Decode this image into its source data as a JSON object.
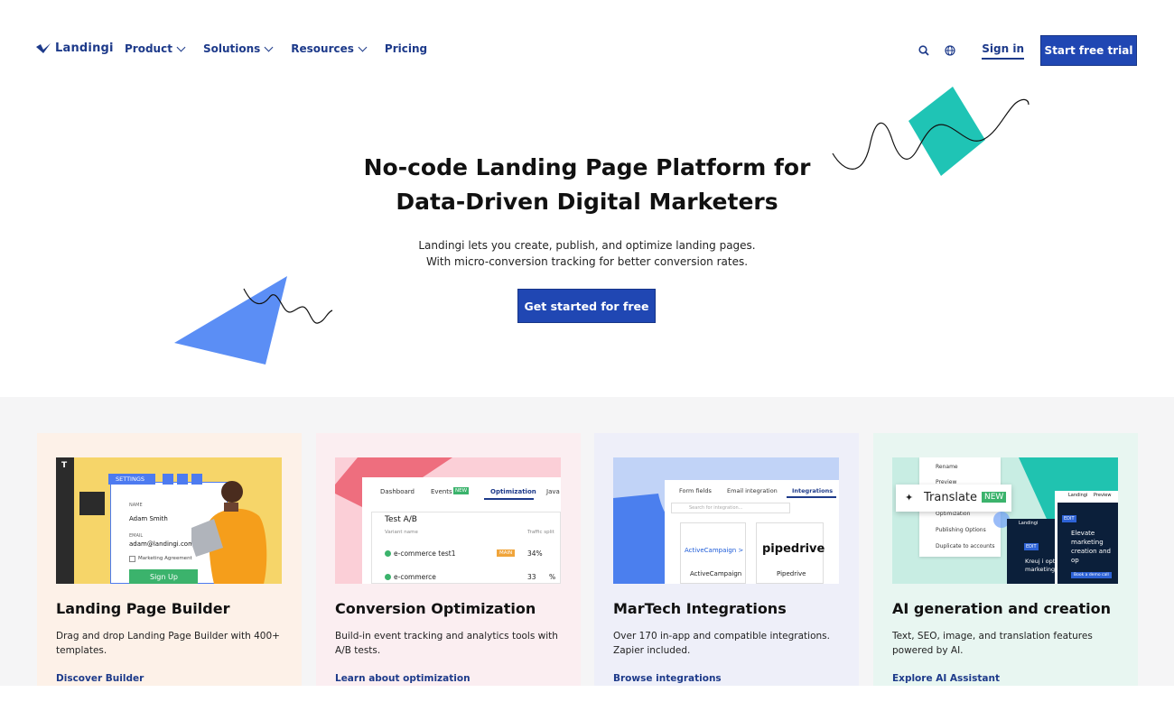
{
  "nav": {
    "logo_text": "Landingi",
    "menu": [
      {
        "label": "Product",
        "dropdown": true
      },
      {
        "label": "Solutions",
        "dropdown": true
      },
      {
        "label": "Resources",
        "dropdown": true
      },
      {
        "label": "Pricing",
        "dropdown": false
      }
    ],
    "search_icon": "search-icon",
    "language_icon": "globe-icon",
    "sign_in": "Sign in",
    "start_trial": "Start free trial"
  },
  "hero": {
    "title_line1_a": "No-code ",
    "title_line1_b": "Landing Page Platform",
    "title_line1_c": " for",
    "title_line2_a": "Data-Driven ",
    "title_line2_b": "Digital Marketers",
    "subtitle_line1": "Landingi lets you create, publish, and optimize landing pages.",
    "subtitle_line2": "With micro-conversion tracking for better conversion rates.",
    "cta": "Get started for free"
  },
  "colors": {
    "brand_blue": "#2047b3",
    "nav_text": "#1d3a8a",
    "teal": "#1fc4b5",
    "triangle_blue": "#5b8ef5"
  },
  "features": [
    {
      "title": "Landing Page Builder",
      "desc": "Drag and drop Landing Page Builder with 400+ templates.",
      "link": "Discover Builder",
      "mock": {
        "settings": "SETTINGS",
        "name_label": "NAME",
        "name_value": "Adam Smith",
        "email_label": "EMAIL",
        "email_value": "adam@landingi.com",
        "checkbox": "Marketing Agreement",
        "button": "Sign Up"
      }
    },
    {
      "title": "Conversion Optimization",
      "desc": "Build-in event tracking and analytics tools with A/B tests.",
      "link": "Learn about optimization",
      "mock": {
        "tabs": [
          "Dashboard",
          "Events",
          "Optimization",
          "Java"
        ],
        "new_badge": "NEW",
        "test_title": "Test A/B",
        "col1": "Variant name",
        "col2": "Traffic split",
        "rows": [
          {
            "name": "e-commerce test1",
            "badge": "MAIN",
            "split": "34%"
          },
          {
            "name": "e-commerce",
            "split": "33",
            "unit": "%"
          }
        ]
      }
    },
    {
      "title": "MarTech Integrations",
      "desc": "Over 170 in-app and compatible integrations. Zapier included.",
      "link": "Browse integrations",
      "mock": {
        "tabs": [
          "Form fields",
          "Email integration",
          "Integrations"
        ],
        "search_placeholder": "Search for integration...",
        "apps": [
          {
            "logo": "ActiveCampaign >",
            "name": "ActiveCampaign"
          },
          {
            "logo": "pipedrive",
            "name": "Pipedrive"
          }
        ]
      }
    },
    {
      "title": "AI generation and creation",
      "desc": "Text, SEO, image, and translation features powered by AI.",
      "link": "Explore AI Assistant",
      "mock": {
        "menu": [
          "Rename",
          "Preview",
          "Optimization",
          "Publishing Options",
          "Duplicate to accounts"
        ],
        "translate": "Translate",
        "new_badge": "NEW",
        "logo_small": "Landingi",
        "preview_word": "Preview",
        "panel_text": "Elevate marketing creation and op",
        "panel_text2": "Kreuj i opt marketing",
        "edit": "EDIT",
        "btn": "Book a demo call"
      }
    }
  ]
}
